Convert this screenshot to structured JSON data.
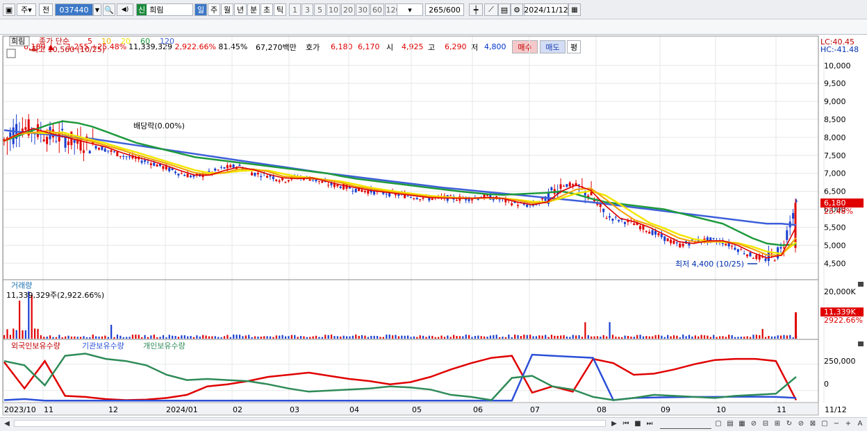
{
  "toolbar": {
    "type_label": "주",
    "prev_label": "전",
    "code": "037440",
    "search_glyph": "🔍",
    "speaker_glyph": "◀)",
    "new_badge": "신",
    "stock_name": "희림",
    "periods": [
      "일",
      "주",
      "월",
      "년",
      "분",
      "초",
      "틱"
    ],
    "selected_period": "일",
    "intervals": [
      "1",
      "3",
      "5",
      "10",
      "20",
      "30",
      "60",
      "120"
    ],
    "count": "265",
    "count_max": "/600",
    "date": "2024/11/12"
  },
  "quote": {
    "price": "6,180",
    "arrow": "▲",
    "change": "1,255",
    "change_pct": "+25.48%",
    "volume": "11,339,329",
    "volume_pct": "2,922.66%",
    "ratio": "81.45%",
    "amount": "67,270백만",
    "hoga_label": "호가",
    "ask": "6,180",
    "bid": "6,170",
    "open_label": "시",
    "open": "4,925",
    "high_label": "고",
    "high": "6,290",
    "low_label": "저",
    "low": "4,800",
    "buy_label": "매수",
    "sell_label": "매도",
    "eval_label": "평"
  },
  "price_panel": {
    "name": "희림",
    "legend_prefix": "종가 단순",
    "ma": [
      {
        "label": "5",
        "color": "#dd0000"
      },
      {
        "label": "10",
        "color": "#f2b800"
      },
      {
        "label": "20",
        "color": "#f2e600"
      },
      {
        "label": "60",
        "color": "#1e9a3c"
      },
      {
        "label": "120",
        "color": "#3d5fd9"
      }
    ],
    "high_note": "최고 10,560 (10/25)",
    "low_note": "최저 4,400 (10/25)",
    "dividend_note": "배당락(0.00%)",
    "lc": "LC:40.45",
    "hc": "HC:-41.48",
    "y_labels": [
      "10,000",
      "9,500",
      "9,000",
      "8,500",
      "8,000",
      "7,500",
      "7,000",
      "6,500",
      "6,000",
      "5,500",
      "5,000",
      "4,500"
    ],
    "last_price": "6,180",
    "last_pct": "25.48%"
  },
  "volume_panel": {
    "title": "거래량",
    "value": "11,339,329주(2,922.66%)",
    "y_label": "20,000K",
    "last": "11,339K",
    "last_pct": "2922.66%"
  },
  "holding_panel": {
    "series": [
      {
        "name": "외국인보유수량",
        "color": "#e00000"
      },
      {
        "name": "기관보유수량",
        "color": "#2b4fd8"
      },
      {
        "name": "개인보유수량",
        "color": "#2e8b57"
      }
    ],
    "y_labels": [
      "250,000",
      "0"
    ]
  },
  "x_axis": {
    "labels": [
      "2023/10",
      "11",
      "12",
      "2024/01",
      "02",
      "03",
      "04",
      "05",
      "06",
      "07",
      "08",
      "09",
      "10",
      "11",
      "11/12"
    ]
  },
  "chart_data": {
    "type": "line",
    "price_range": [
      4400,
      10560
    ],
    "close": [
      7900,
      8300,
      8200,
      8050,
      8000,
      7850,
      7800,
      7650,
      7500,
      7400,
      7300,
      7150,
      7000,
      6900,
      7000,
      7150,
      7200,
      7000,
      6950,
      6800,
      6900,
      6850,
      6700,
      6650,
      6550,
      6500,
      6450,
      6400,
      6350,
      6300,
      6320,
      6300,
      6310,
      6350,
      6250,
      6150,
      6100,
      6300,
      6700,
      6650,
      6400,
      5800,
      5700,
      5600,
      5400,
      5200,
      5000,
      5100,
      5150,
      5100,
      4900,
      4700,
      4600,
      4850,
      6180
    ],
    "ma120": [
      8200,
      8150,
      8120,
      8080,
      8030,
      7990,
      7960,
      7900,
      7840,
      7780,
      7720,
      7660,
      7600,
      7540,
      7480,
      7420,
      7360,
      7300,
      7240,
      7180,
      7120,
      7060,
      7000,
      6950,
      6900,
      6850,
      6800,
      6750,
      6700,
      6650,
      6600,
      6560,
      6520,
      6480,
      6440,
      6400,
      6360,
      6320,
      6280,
      6240,
      6200,
      6150,
      6100,
      6050,
      6000,
      5950,
      5900,
      5850,
      5800,
      5750,
      5700,
      5650,
      5600,
      5600,
      5560
    ],
    "ma60": [
      7900,
      8050,
      8200,
      8350,
      8450,
      8400,
      8300,
      8150,
      8000,
      7850,
      7750,
      7650,
      7550,
      7450,
      7400,
      7350,
      7300,
      7250,
      7200,
      7150,
      7100,
      7050,
      7000,
      6920,
      6850,
      6800,
      6750,
      6700,
      6650,
      6600,
      6550,
      6500,
      6460,
      6420,
      6400,
      6420,
      6440,
      6460,
      6500,
      6420,
      6300,
      6200,
      6150,
      6100,
      6050,
      6000,
      5900,
      5800,
      5700,
      5600,
      5400,
      5200,
      5050,
      5000,
      5020
    ],
    "volume_peaks": [
      {
        "x": "2023/10",
        "value": "20,000K"
      },
      {
        "x": "11/12",
        "value": "11,339K"
      }
    ],
    "holding": {
      "foreign": [
        270000,
        20000,
        280000,
        -50000,
        -60000,
        -80000,
        -90000,
        -85000,
        -70000,
        -40000,
        40000,
        60000,
        90000,
        130000,
        150000,
        170000,
        140000,
        110000,
        90000,
        60000,
        80000,
        130000,
        200000,
        260000,
        310000,
        330000,
        -20000,
        40000,
        -10000,
        300000,
        260000,
        150000,
        160000,
        200000,
        250000,
        290000,
        300000,
        300000,
        280000,
        -90000
      ],
      "institution": [
        -90000,
        -80000,
        -95000,
        -95000,
        -95000,
        -95000,
        -95000,
        -95000,
        -95000,
        -95000,
        -95000,
        -95000,
        -95000,
        -95000,
        -95000,
        -95000,
        -95000,
        -95000,
        -95000,
        -95000,
        -95000,
        -95000,
        -95000,
        -95000,
        -95000,
        -95000,
        340000,
        330000,
        320000,
        310000,
        -90000,
        -70000,
        -65000,
        -62000,
        -60000,
        -60000,
        -58000,
        -58000,
        -60000,
        -70000
      ],
      "individual": [
        280000,
        240000,
        50000,
        330000,
        350000,
        300000,
        280000,
        240000,
        150000,
        100000,
        110000,
        100000,
        90000,
        60000,
        20000,
        -10000,
        0,
        10000,
        20000,
        40000,
        30000,
        10000,
        -40000,
        -60000,
        -90000,
        120000,
        140000,
        40000,
        10000,
        -60000,
        -90000,
        -70000,
        -40000,
        -50000,
        -60000,
        -70000,
        -50000,
        -40000,
        -30000,
        130000
      ]
    }
  }
}
